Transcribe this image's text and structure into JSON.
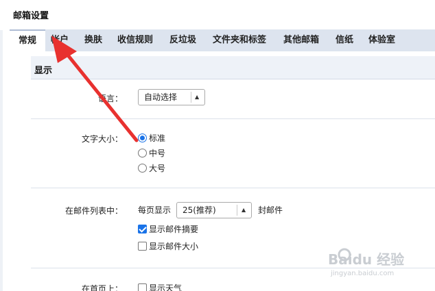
{
  "page_title": "邮箱设置",
  "tabs": [
    {
      "label": "常规",
      "active": true
    },
    {
      "label": "帐户"
    },
    {
      "label": "换肤"
    },
    {
      "label": "收信规则"
    },
    {
      "label": "反垃圾"
    },
    {
      "label": "文件夹和标签"
    },
    {
      "label": "其他邮箱"
    },
    {
      "label": "信纸"
    },
    {
      "label": "体验室"
    }
  ],
  "section": {
    "title": "显示"
  },
  "language": {
    "label": "语言：",
    "value": "自动选择"
  },
  "font_size": {
    "label": "文字大小：",
    "options": [
      {
        "label": "标准",
        "selected": true
      },
      {
        "label": "中号",
        "selected": false
      },
      {
        "label": "大号",
        "selected": false
      }
    ]
  },
  "mail_list": {
    "label": "在邮件列表中：",
    "per_page_prefix": "每页显示",
    "per_page_value": "25(推荐)",
    "per_page_suffix": "封邮件",
    "show_summary": {
      "label": "显示邮件摘要",
      "checked": true
    },
    "show_size": {
      "label": "显示邮件大小",
      "checked": false
    }
  },
  "home_page": {
    "label": "在首页上：",
    "show_weather": {
      "label": "显示天气",
      "checked": false
    }
  },
  "annotation": {
    "color": "#e8312f"
  },
  "watermark": {
    "text": "Baidu 经验",
    "url": "jingyan.baidu.com",
    "color": "#c9cdd2"
  },
  "colors": {
    "tabbar": "#dde4ef",
    "accent": "#1a73e8"
  }
}
